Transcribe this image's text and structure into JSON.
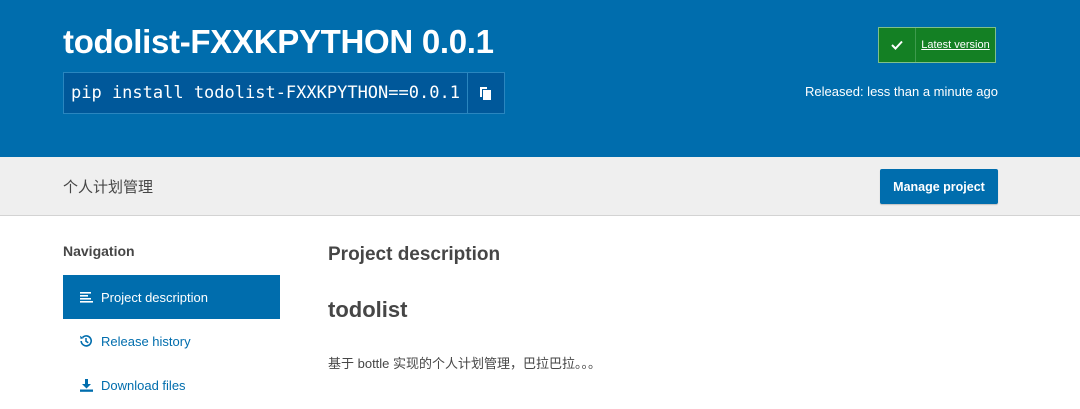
{
  "header": {
    "title": "todolist-FXXKPYTHON 0.0.1",
    "pip_command": "pip install todolist-FXXKPYTHON==0.0.1",
    "latest_version_label": "Latest version",
    "released_text": "Released: less than a minute ago"
  },
  "summary": {
    "text": "个人计划管理",
    "manage_button": "Manage project"
  },
  "navigation": {
    "heading": "Navigation",
    "items": [
      {
        "label": "Project description",
        "icon": "align-left-icon",
        "active": true
      },
      {
        "label": "Release history",
        "icon": "history-icon",
        "active": false
      },
      {
        "label": "Download files",
        "icon": "download-icon",
        "active": false
      }
    ]
  },
  "content": {
    "section_heading": "Project description",
    "readme_title": "todolist",
    "readme_text": "基于 bottle 实现的个人计划管理，巴拉巴拉。。。"
  },
  "colors": {
    "brand_blue": "#006dad",
    "success_green": "#148024",
    "summary_bg": "#efefef"
  }
}
